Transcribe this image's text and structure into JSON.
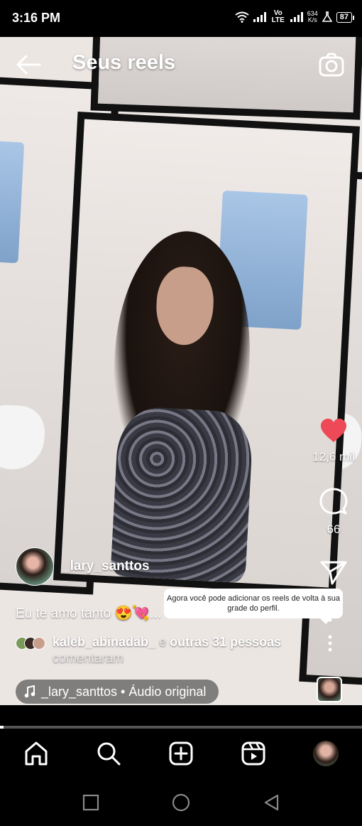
{
  "status_bar": {
    "time": "3:16 PM",
    "volte": "Vo LTE",
    "speed_value": "634",
    "speed_unit": "K/s",
    "battery": "87"
  },
  "header": {
    "title": "Seus reels",
    "back_icon": "arrow-left-icon",
    "camera_icon": "camera-icon"
  },
  "actions": {
    "likes": "12,6 mil",
    "comments": "66",
    "like_color": "#ED4956"
  },
  "post": {
    "author": "_lary_santtos",
    "caption": "Eu te amo tanto",
    "caption_suffix": "..."
  },
  "tooltip": {
    "text": "Agora você pode adicionar os reels de volta à sua grade do perfil."
  },
  "comments": {
    "user": "kaleb_abinadab_",
    "connector": " e ",
    "others": "outras 31 pessoas",
    "verb": "comentaram"
  },
  "audio": {
    "label": "_lary_santtos • Áudio original"
  },
  "progress": {
    "fraction": 0.01
  },
  "nav": {
    "items": [
      "home-icon",
      "search-icon",
      "create-icon",
      "reels-icon",
      "profile-avatar"
    ]
  }
}
